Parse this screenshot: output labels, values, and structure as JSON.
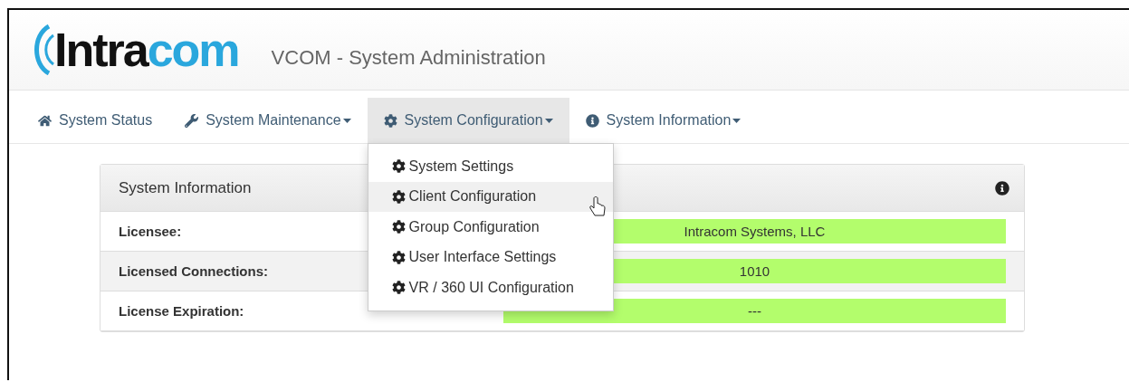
{
  "header": {
    "logo_parts": [
      "Intra",
      "com"
    ],
    "title": "VCOM - System Administration"
  },
  "nav": [
    {
      "label": "System Status",
      "kind": "home",
      "dropdown": false,
      "selected": false
    },
    {
      "label": "System Maintenance",
      "kind": "wrench",
      "dropdown": true,
      "selected": false
    },
    {
      "label": "System Configuration",
      "kind": "gear",
      "dropdown": true,
      "selected": true
    },
    {
      "label": "System Information",
      "kind": "info",
      "dropdown": true,
      "selected": false
    }
  ],
  "menu": {
    "items": [
      {
        "label": "System Settings",
        "selected": false
      },
      {
        "label": "Client Configuration",
        "selected": true
      },
      {
        "label": "Group Configuration",
        "selected": false
      },
      {
        "label": "User Interface Settings",
        "selected": false
      },
      {
        "label": "VR / 360 UI Configuration",
        "selected": false
      }
    ]
  },
  "panel": {
    "title": "System Information",
    "rows": [
      {
        "label": "Licensee:",
        "value": "Intracom Systems, LLC"
      },
      {
        "label": "Licensed Connections:",
        "value": "1010"
      },
      {
        "label": "License Expiration:",
        "value": "---"
      }
    ]
  }
}
